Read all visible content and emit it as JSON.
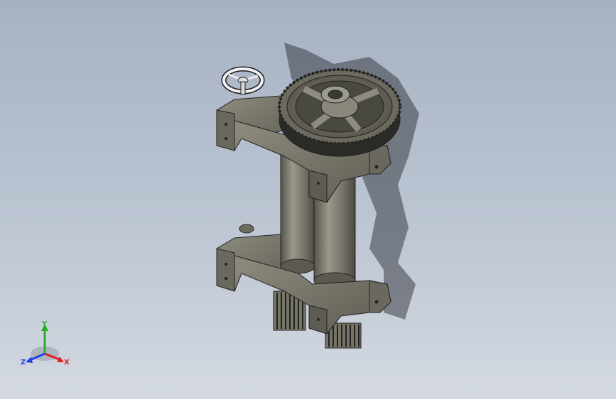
{
  "viewport": {
    "background_top": "#a6b1c2",
    "background_bottom": "#d4d9e1"
  },
  "model": {
    "body_color": "#7d7b6c",
    "dark_color": "#2a2a26",
    "shadow_color": "#3a3e45"
  },
  "triad": {
    "x_label": "X",
    "y_label": "Y",
    "z_label": "Z",
    "x_color": "#e02020",
    "y_color": "#28b028",
    "z_color": "#2040e0"
  }
}
